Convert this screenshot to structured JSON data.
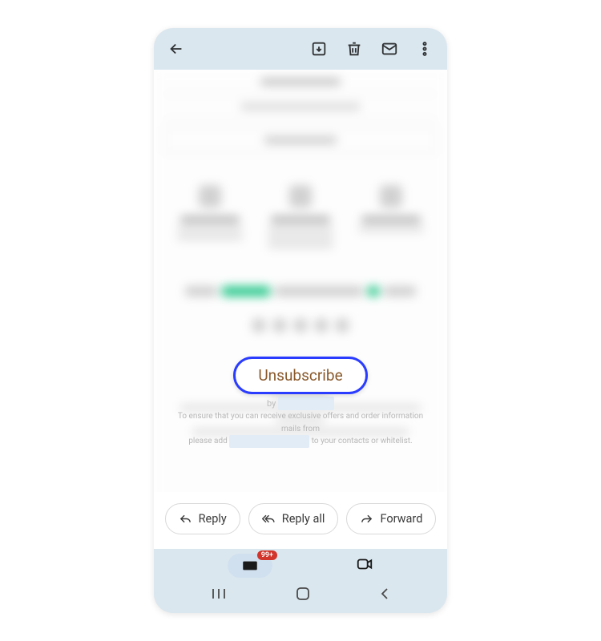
{
  "topbar": {
    "back_label": "Back",
    "archive_label": "Archive",
    "delete_label": "Delete",
    "unread_label": "Mark unread",
    "more_label": "More options"
  },
  "callout": {
    "unsubscribe_label": "Unsubscribe"
  },
  "footer": {
    "by": "by",
    "line1": "To ensure that you can receive exclusive offers and order information mails from",
    "line2a": "please add",
    "line2b": "to your contacts or whitelist."
  },
  "actions": {
    "reply": "Reply",
    "reply_all": "Reply all",
    "forward": "Forward"
  },
  "tabs": {
    "mail_badge": "99+"
  }
}
